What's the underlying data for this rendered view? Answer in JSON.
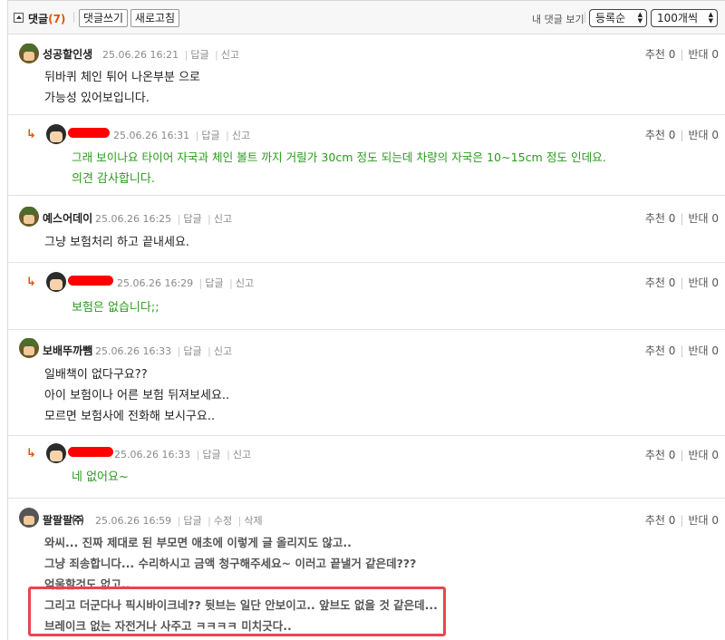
{
  "header": {
    "title": "댓글",
    "count": "(7)",
    "write_button": "댓글쓰기",
    "refresh_button": "새로고침",
    "my_comments": "내 댓글 보기",
    "sort_select": "등록순",
    "perpage_select": "100개씩"
  },
  "vote_labels": {
    "up": "추천",
    "down": "반대"
  },
  "comments": [
    {
      "author": "성공할인생",
      "datetime": "25.06.26 16:21",
      "actions": [
        "답글",
        "신고"
      ],
      "lines": [
        "뒤바퀴 체인 튀어 나온부분 으로",
        "가능성 있어보입니다."
      ],
      "up": "0",
      "down": "0"
    },
    {
      "author": "",
      "datetime": "25.06.26 16:31",
      "actions": [
        "답글",
        "신고"
      ],
      "lines": [
        "그래 보이나요 타이어 자국과 체인 볼트 까지 거릴가 30cm 정도 되는데 차량의 자국은 10~15cm 정도 인데요.",
        "의견 감사합니다."
      ],
      "up": "0",
      "down": "0"
    },
    {
      "author": "예스어데이",
      "datetime": "25.06.26 16:25",
      "actions": [
        "답글",
        "신고"
      ],
      "lines": [
        "그냥 보험처리 하고 끝내세요."
      ],
      "up": "0",
      "down": "0"
    },
    {
      "author": "",
      "datetime": "25.06.26 16:29",
      "actions": [
        "답글",
        "신고"
      ],
      "lines": [
        "보험은 없습니다;;"
      ],
      "up": "0",
      "down": "0"
    },
    {
      "author": "보배뚜까뺌",
      "datetime": "25.06.26 16:33",
      "actions": [
        "답글",
        "신고"
      ],
      "lines": [
        "일배책이 없다구요??",
        "아이 보험이나 어른 보험 뒤져보세요..",
        "모르면 보험사에 전화해 보시구요.."
      ],
      "up": "0",
      "down": "0"
    },
    {
      "author": "",
      "datetime": "25.06.26 16:33",
      "actions": [
        "답글",
        "신고"
      ],
      "lines": [
        "네 없어요~"
      ],
      "up": "0",
      "down": "0"
    },
    {
      "author": "팔팔팔㈜",
      "datetime": "25.06.26 16:59",
      "actions": [
        "답글",
        "수정",
        "삭제"
      ],
      "lines": [
        "와씨... 진짜 제대로 된 부모면 애초에 이렇게 글 올리지도 않고..",
        "그냥 죄송합니다... 수리하시고 금액 청구해주세요~ 이러고 끝낼거 같은데???",
        "억울할것도 없고..",
        "그리고 더군다나 픽시바이크네?? 뒷브는 일단 안보이고.. 앞브도 없을 것 같은데...",
        "브레이크 없는 자전거나 사주고 ㅋㅋㅋㅋ 미치긋다.."
      ],
      "up": "0",
      "down": "0"
    }
  ]
}
